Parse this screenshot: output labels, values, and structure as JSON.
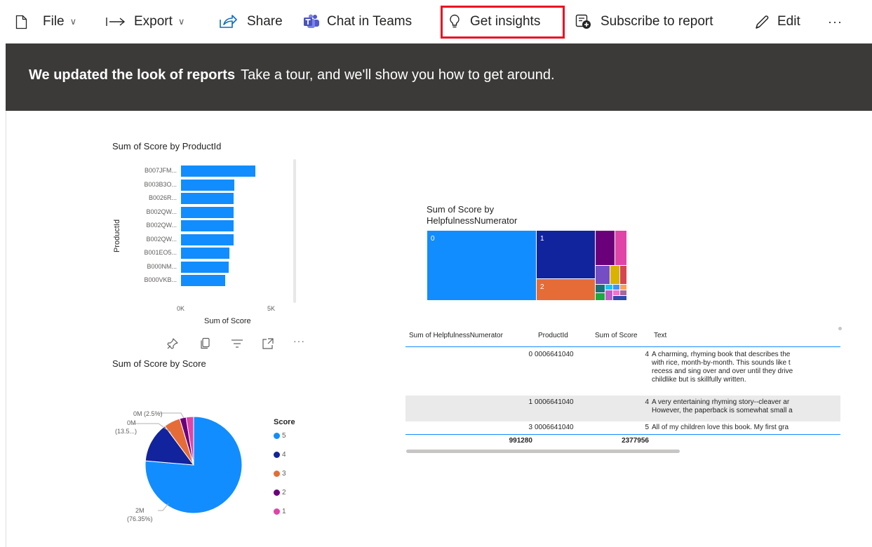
{
  "toolbar": {
    "file": "File",
    "export": "Export",
    "share": "Share",
    "chat": "Chat in Teams",
    "insights": "Get insights",
    "subscribe": "Subscribe to report",
    "edit": "Edit",
    "more": "···"
  },
  "banner": {
    "title": "We updated the look of reports",
    "text": "Take a tour, and we'll show you how to get around."
  },
  "charts": {
    "bar": {
      "title": "Sum of Score by ProductId",
      "ylabel": "ProductId",
      "xlabel": "Sum of Score",
      "xticks": [
        "0K",
        "5K"
      ]
    },
    "pie": {
      "title": "Sum of Score by Score",
      "legend_title": "Score",
      "labels": {
        "l1_a": "0M (2.5%)",
        "l2_a": "0M",
        "l2_b": "(13.5...)",
        "l3_a": "2M",
        "l3_b": "(76.35%)"
      }
    },
    "treemap": {
      "title_line1": "Sum of Score by",
      "title_line2": "HelpfulnessNumerator"
    }
  },
  "table": {
    "headers": [
      "Sum of HelpfulnessNumerator",
      "ProductId",
      "Sum of Score",
      "Text"
    ],
    "rows": [
      {
        "helpful": "0",
        "product": "0006641040",
        "score": "4",
        "text": [
          "A charming, rhyming book that describes the",
          "with rice, month-by-month. This sounds like t",
          "recess and sing over and over until they drive",
          "childlike but is skillfully written."
        ]
      },
      {
        "helpful": "1",
        "product": "0006641040",
        "score": "4",
        "text": [
          "A very entertaining rhyming story--cleaver ar",
          "However, the paperback is somewhat small a"
        ]
      },
      {
        "helpful": "3",
        "product": "0006641040",
        "score": "5",
        "text": [
          "All of my children love this book. My first gra"
        ]
      }
    ],
    "totals": {
      "helpful": "991280",
      "score": "2377956"
    }
  },
  "chart_data": [
    {
      "type": "bar",
      "title": "Sum of Score by ProductId",
      "xlabel": "Sum of Score",
      "ylabel": "ProductId",
      "orientation": "horizontal",
      "categories": [
        "B007JFM...",
        "B003B3O...",
        "B0026R...",
        "B002QW...",
        "B002QW...",
        "B002QW...",
        "B001EO5...",
        "B000NM...",
        "B000VKB..."
      ],
      "values": [
        4600,
        3300,
        3250,
        3250,
        3250,
        3250,
        3000,
        2950,
        2750
      ],
      "xlim": [
        0,
        7500
      ],
      "xticks": [
        "0K",
        "5K"
      ]
    },
    {
      "type": "pie",
      "title": "Sum of Score by Score",
      "legend_title": "Score",
      "categories": [
        "5",
        "4",
        "3",
        "2",
        "1"
      ],
      "values": [
        76.35,
        13.5,
        5.5,
        2.15,
        2.5
      ],
      "colors": [
        "#118dff",
        "#12239e",
        "#e66c37",
        "#6b007b",
        "#e044a7"
      ]
    },
    {
      "type": "treemap",
      "title": "Sum of Score by HelpfulnessNumerator",
      "categories": [
        "0",
        "1",
        "2"
      ],
      "colors": [
        "#118dff",
        "#12239e",
        "#e66c37",
        "#6b007b",
        "#e044a7",
        "#744ec2",
        "#d9b300",
        "#d64550",
        "#197278",
        "#1aab40"
      ]
    }
  ]
}
